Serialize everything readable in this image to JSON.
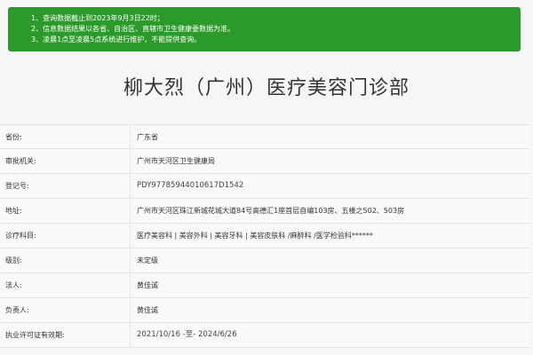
{
  "notice": {
    "lines": [
      "1、查询数据截止到2023年9月3日22时；",
      "2、信息数据结果以各省、自治区、直辖市卫生健康委数据为准。",
      "3、凌晨1点至凌晨5点系统进行维护，不能提供查询。"
    ],
    "bg_color": "#2a9a2a"
  },
  "title": "柳大烈（广州）医疗美容门诊部",
  "details": [
    {
      "label": "省份:",
      "value": "广东省"
    },
    {
      "label": "审批机关:",
      "value": "广州市天河区卫生健康局"
    },
    {
      "label": "登记号:",
      "value": "PDY97785944010617D1542"
    },
    {
      "label": "地址:",
      "value": "广州市天河区珠江新城花城大道84号高德汇1座首层自编103房、五楼之502、503房"
    },
    {
      "label": "诊疗科目:",
      "value": "医疗美容科 | 美容外科 | 美容牙科 | 美容皮肤科 /麻醉科 /医学检验科******"
    },
    {
      "label": "级别:",
      "value": "未定级"
    },
    {
      "label": "法人:",
      "value": "黄佳诚"
    },
    {
      "label": "负责人:",
      "value": "黄佳诚"
    },
    {
      "label": "执业许可证有效期:",
      "value": "2021/10/16 -至- 2024/6/26"
    }
  ]
}
